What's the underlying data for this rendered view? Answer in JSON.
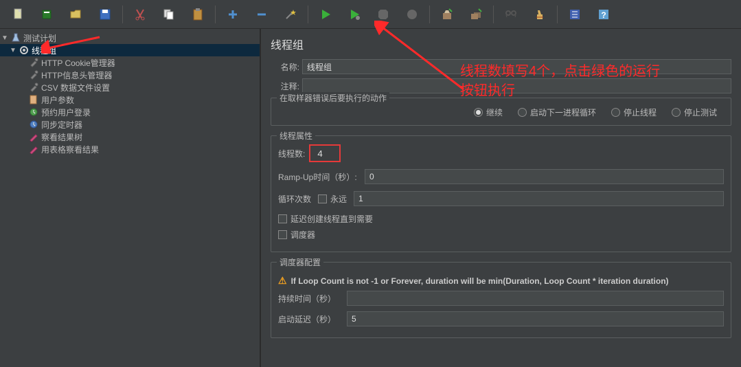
{
  "toolbar": {
    "icons": [
      "new-file",
      "templates",
      "open",
      "save",
      "scissors",
      "copy",
      "paste",
      "plus",
      "minus",
      "wand",
      "play",
      "play-dot",
      "stop",
      "stop-remote",
      "clean",
      "cleanup",
      "binoculars",
      "broom",
      "options",
      "help"
    ]
  },
  "tree": {
    "root": {
      "label": "测试计划"
    },
    "threadGroup": {
      "label": "线程组"
    },
    "children": [
      {
        "label": "HTTP Cookie管理器",
        "icon": "wrench"
      },
      {
        "label": "HTTP信息头管理器",
        "icon": "wrench"
      },
      {
        "label": "CSV 数据文件设置",
        "icon": "wrench"
      },
      {
        "label": "用户参数",
        "icon": "doc"
      },
      {
        "label": "预约用户登录",
        "icon": "clock-green"
      },
      {
        "label": "同步定时器",
        "icon": "clock-blue"
      },
      {
        "label": "察看结果树",
        "icon": "pencil"
      },
      {
        "label": "用表格察看结果",
        "icon": "pencil"
      }
    ]
  },
  "panel": {
    "title": "线程组",
    "nameLabel": "名称:",
    "nameValue": "线程组",
    "remarkLabel": "注释:",
    "remarkValue": ""
  },
  "errorAction": {
    "legend": "在取样器错误后要执行的动作",
    "opts": [
      {
        "label": "继续",
        "checked": true
      },
      {
        "label": "启动下一进程循环",
        "checked": false
      },
      {
        "label": "停止线程",
        "checked": false
      },
      {
        "label": "停止测试",
        "checked": false
      }
    ]
  },
  "threadProps": {
    "legend": "线程属性",
    "threadCountLabel": "线程数:",
    "threadCountValue": "4",
    "rampLabel": "Ramp-Up时间（秒）:",
    "rampValue": "0",
    "loopLabel": "循环次数",
    "foreverLabel": "永远",
    "loopValue": "1",
    "delayCreateLabel": "延迟创建线程直到需要",
    "schedulerLabel": "调度器"
  },
  "scheduler": {
    "legend": "调度器配置",
    "warnText": "If Loop Count is not -1 or Forever, duration will be min(Duration, Loop Count * iteration duration)",
    "durationLabel": "持续时间（秒）",
    "durationValue": "",
    "delayLabel": "启动延迟（秒）",
    "delayValue": "5"
  },
  "annotation": {
    "line1": "线程数填写4个，点击绿色的运行",
    "line2": "按钮执行"
  }
}
